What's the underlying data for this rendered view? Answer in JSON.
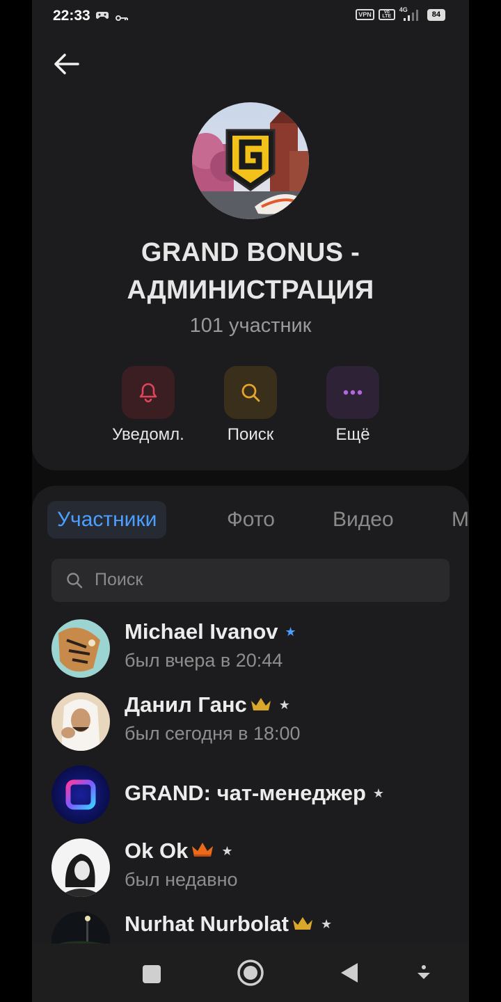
{
  "status_bar": {
    "time": "22:33",
    "vpn": "VPN",
    "volte": "Vo LTE",
    "network": "4G",
    "battery": "84"
  },
  "profile": {
    "title_line1": "GRAND BONUS -",
    "title_line2": "АДМИНИСТРАЦИЯ",
    "subtitle": "101 участник",
    "actions": [
      {
        "label": "Уведомл.",
        "icon": "bell-icon",
        "color": "#e0455a",
        "bg": "#3a1e22"
      },
      {
        "label": "Поиск",
        "icon": "search-icon",
        "color": "#e5a52a",
        "bg": "#3a2f1a"
      },
      {
        "label": "Ещё",
        "icon": "more-icon",
        "color": "#b468e0",
        "bg": "#2e2236"
      }
    ]
  },
  "tabs": [
    {
      "label": "Участники",
      "active": true
    },
    {
      "label": "Фото",
      "active": false
    },
    {
      "label": "Видео",
      "active": false
    },
    {
      "label": "М",
      "active": false
    }
  ],
  "search": {
    "placeholder": "Поиск"
  },
  "members": [
    {
      "name": "Michael Ivanov",
      "status": "был вчера в 20:44",
      "star_color": "#4d9fff",
      "crown": false
    },
    {
      "name": "Данил Ганс",
      "status": "был сегодня в 18:00",
      "star_color": "#d8d8d8",
      "crown": true
    },
    {
      "name": "GRAND: чат-менеджер",
      "status": "",
      "star_color": "#d8d8d8",
      "crown": false
    },
    {
      "name": "Ok Ok",
      "status": "был недавно",
      "star_color": "#d8d8d8",
      "crown": true
    },
    {
      "name": "Nurhat Nurbolat",
      "status": "",
      "star_color": "#d8d8d8",
      "crown": true
    }
  ],
  "colors": {
    "accent": "#4d9fff",
    "card": "#1c1c1e",
    "background": "#0e0e0e"
  }
}
